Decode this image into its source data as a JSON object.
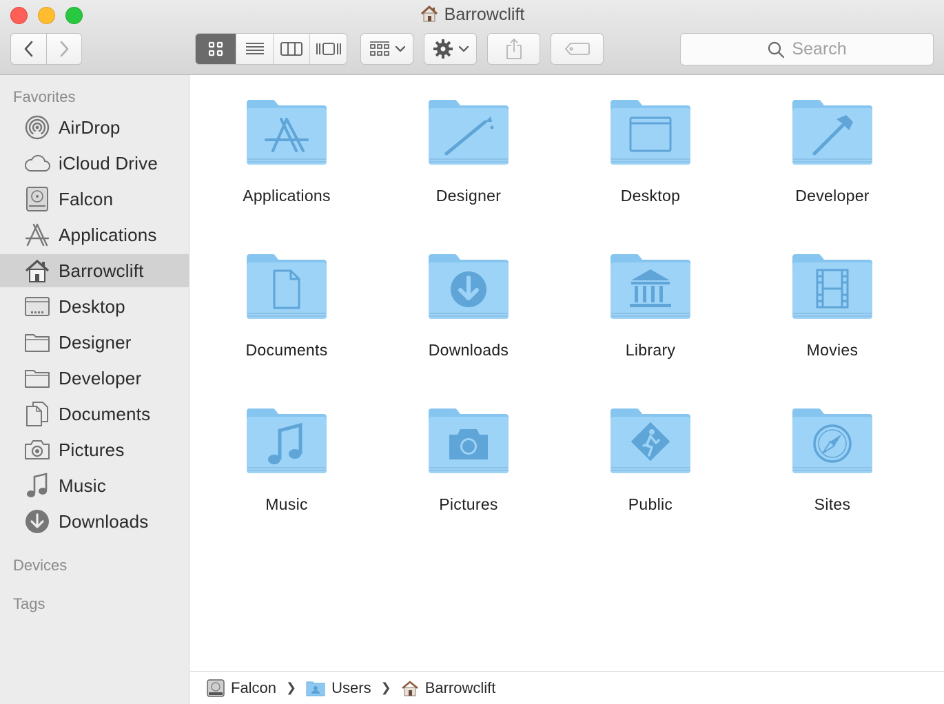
{
  "window": {
    "title": "Barrowclift"
  },
  "toolbar": {
    "search_placeholder": "Search"
  },
  "sidebar": {
    "favorites_header": "Favorites",
    "items": [
      {
        "label": "AirDrop",
        "icon": "airdrop-icon"
      },
      {
        "label": "iCloud Drive",
        "icon": "cloud-icon"
      },
      {
        "label": "Falcon",
        "icon": "hard-drive-icon"
      },
      {
        "label": "Applications",
        "icon": "applications-icon"
      },
      {
        "label": "Barrowclift",
        "icon": "home-icon",
        "selected": true
      },
      {
        "label": "Desktop",
        "icon": "desktop-icon"
      },
      {
        "label": "Designer",
        "icon": "folder-icon"
      },
      {
        "label": "Developer",
        "icon": "folder-icon"
      },
      {
        "label": "Documents",
        "icon": "documents-icon"
      },
      {
        "label": "Pictures",
        "icon": "camera-icon"
      },
      {
        "label": "Music",
        "icon": "music-note-icon"
      },
      {
        "label": "Downloads",
        "icon": "download-icon"
      }
    ],
    "devices_header": "Devices",
    "tags_header": "Tags"
  },
  "folders": [
    {
      "label": "Applications",
      "emblem": "applications-icon"
    },
    {
      "label": "Designer",
      "emblem": "brush-icon"
    },
    {
      "label": "Desktop",
      "emblem": "window-icon"
    },
    {
      "label": "Developer",
      "emblem": "hammer-icon"
    },
    {
      "label": "Documents",
      "emblem": "document-icon"
    },
    {
      "label": "Downloads",
      "emblem": "download-icon"
    },
    {
      "label": "Library",
      "emblem": "library-icon"
    },
    {
      "label": "Movies",
      "emblem": "film-icon"
    },
    {
      "label": "Music",
      "emblem": "music-note-icon"
    },
    {
      "label": "Pictures",
      "emblem": "camera-icon"
    },
    {
      "label": "Public",
      "emblem": "public-icon"
    },
    {
      "label": "Sites",
      "emblem": "compass-icon"
    }
  ],
  "pathbar": {
    "crumbs": [
      "Falcon",
      "Users",
      "Barrowclift"
    ]
  },
  "colors": {
    "folder_light": "#9dd3f7",
    "folder_dark": "#7ebde9",
    "sidebar_bg": "#ececec",
    "selected_bg": "#d2d2d2"
  }
}
